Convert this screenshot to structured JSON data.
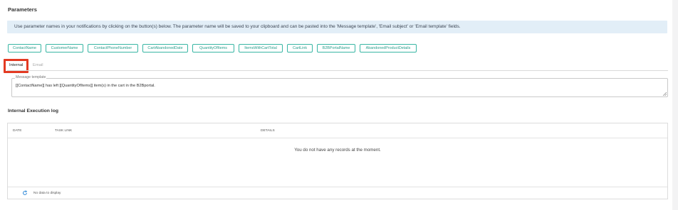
{
  "parameters": {
    "title": "Parameters",
    "info": "Use parameter names in your notifications by clicking on the button(s) below. The parameter name will be saved to your clipboard and can be pasted into the 'Message template', 'Email subject' or 'Email template' fields.",
    "buttons": [
      "ContactName",
      "CustomerName",
      "ContactPhoneNumber",
      "CartAbandonedDate",
      "QuantityOfItems",
      "ItemsWithCartTotal",
      "CartLink",
      "B2BPortalName",
      "AbandonedProductDetails"
    ]
  },
  "tabs": {
    "internal": "Internal",
    "email": "Email",
    "active": "Internal"
  },
  "template": {
    "label": "Message template",
    "value": "[[ContactName]] has left [[QuantityOfItems]] item(s) in the cart in the B2Bportal."
  },
  "log": {
    "title": "Internal Execution log",
    "columns": [
      "DATE",
      "TASK LINK",
      "DETAILS"
    ],
    "empty_message": "You do not have any records at the moment.",
    "footer_text": "No data to display"
  },
  "colors": {
    "accent": "#2aa08e",
    "highlight": "#e33a22",
    "info_bg": "#e2eef7"
  }
}
